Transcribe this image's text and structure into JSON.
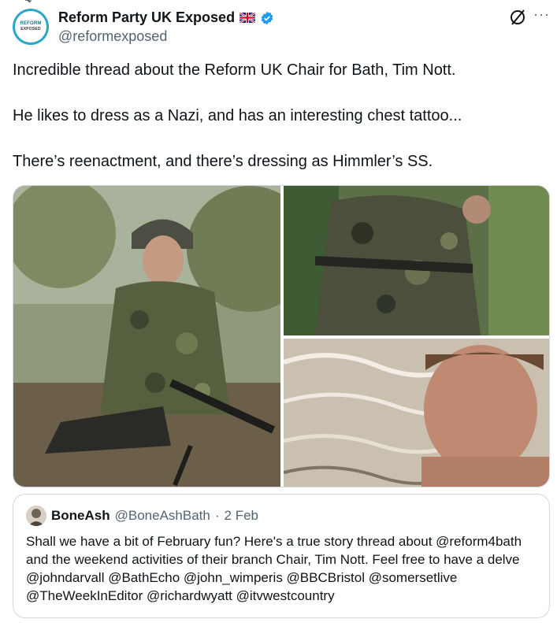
{
  "tweet": {
    "author_name": "Reform Party UK Exposed",
    "author_handle": "@reformexposed",
    "avatar_text_line1": "REFORM",
    "avatar_text_line2": "EXPOSED",
    "more_label": "···",
    "paragraphs": [
      "Incredible thread about the Reform UK Chair for Bath, Tim Nott.",
      "He likes to dress as a Nazi, and has an interesting chest tattoo...",
      "There’s reenactment, and there’s dressing as Himmler’s SS."
    ],
    "icons": {
      "flag": "uk-flag-icon",
      "verified": "verified-badge-icon",
      "grok": "grok-icon",
      "more": "more-icon"
    },
    "colors": {
      "verified": "#1d9bf0",
      "secondary_text": "#536471",
      "avatar_ring": "#2aa6c9"
    }
  },
  "quote": {
    "name": "BoneAsh",
    "handle": "@BoneAshBath",
    "dot": "·",
    "date": "2 Feb",
    "text": "Shall we have a bit of February fun? Here's a true story thread about @reform4bath and the weekend activities of their branch Chair, Tim Nott. Feel free to have a delve @johndarvall @BathEcho @john_wimperis @BBCBristol @somersetlive @TheWeekInEditor @richardwyatt @itvwestcountry"
  }
}
